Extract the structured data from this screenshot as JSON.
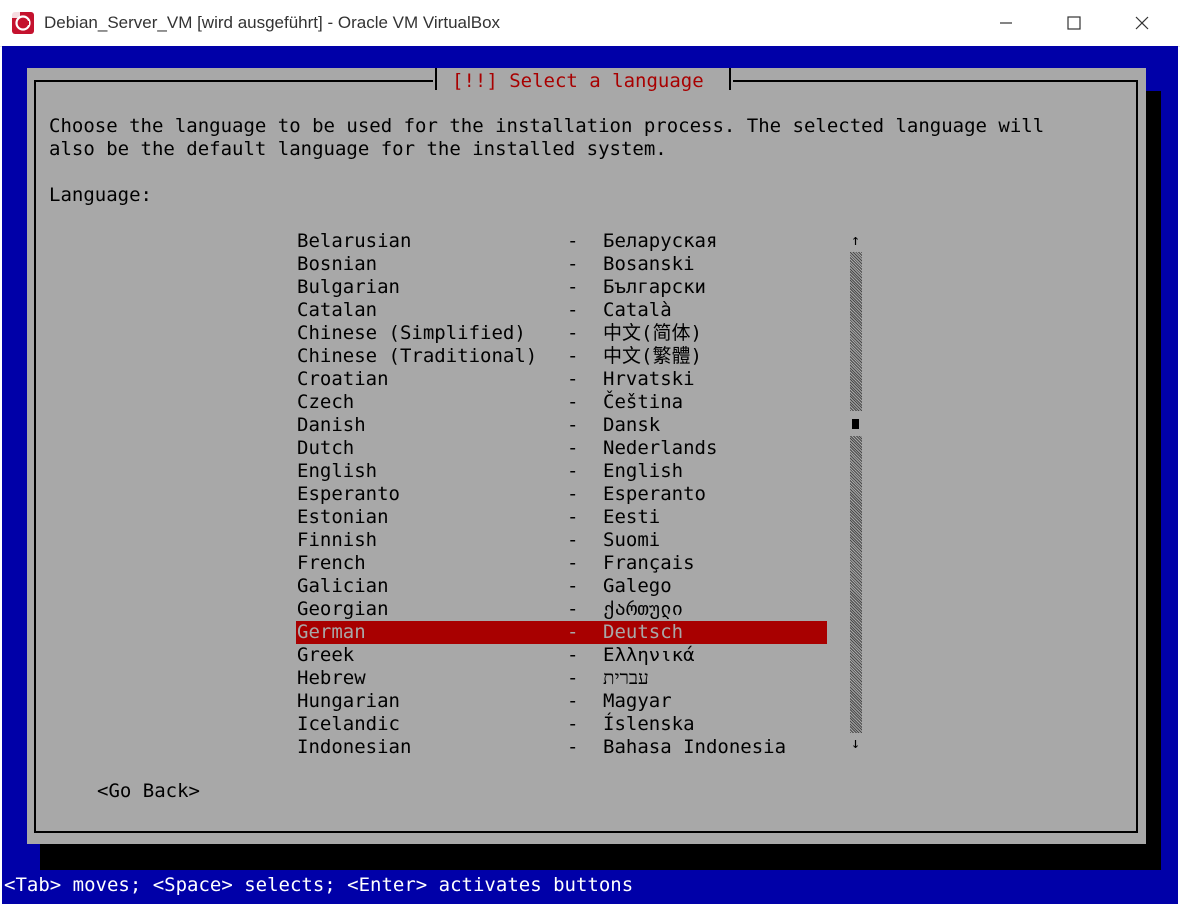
{
  "window": {
    "title": "Debian_Server_VM [wird ausgeführt] - Oracle VM VirtualBox",
    "icon": "virtualbox-debian-icon",
    "controls": {
      "minimize": "minimize-icon",
      "maximize": "maximize-icon",
      "close": "close-icon"
    }
  },
  "colors": {
    "screen_bg": "#0000a8",
    "dialog_bg": "#a8a8a8",
    "title_text": "#a80000",
    "selection_bg": "#a80000",
    "help_text": "#ffffff"
  },
  "dialog": {
    "title": "[!!] Select a language",
    "description_line_1": "Choose the language to be used for the installation process. The selected language will",
    "description_line_2": "also be the default language for the installed system.",
    "list_label": "Language:",
    "go_back": "<Go Back>"
  },
  "languages": [
    {
      "name": "Belarusian",
      "sep": "-",
      "native": "Беларуская"
    },
    {
      "name": "Bosnian",
      "sep": "-",
      "native": "Bosanski"
    },
    {
      "name": "Bulgarian",
      "sep": "-",
      "native": "Български"
    },
    {
      "name": "Catalan",
      "sep": "-",
      "native": "Català"
    },
    {
      "name": "Chinese (Simplified)",
      "sep": "-",
      "native": "中文(简体)"
    },
    {
      "name": "Chinese (Traditional)",
      "sep": "-",
      "native": "中文(繁體)"
    },
    {
      "name": "Croatian",
      "sep": "-",
      "native": "Hrvatski"
    },
    {
      "name": "Czech",
      "sep": "-",
      "native": "Čeština"
    },
    {
      "name": "Danish",
      "sep": "-",
      "native": "Dansk"
    },
    {
      "name": "Dutch",
      "sep": "-",
      "native": "Nederlands"
    },
    {
      "name": "English",
      "sep": "-",
      "native": "English"
    },
    {
      "name": "Esperanto",
      "sep": "-",
      "native": "Esperanto"
    },
    {
      "name": "Estonian",
      "sep": "-",
      "native": "Eesti"
    },
    {
      "name": "Finnish",
      "sep": "-",
      "native": "Suomi"
    },
    {
      "name": "French",
      "sep": "-",
      "native": "Français"
    },
    {
      "name": "Galician",
      "sep": "-",
      "native": "Galego"
    },
    {
      "name": "Georgian",
      "sep": "-",
      "native": "ქართული"
    },
    {
      "name": "German",
      "sep": "-",
      "native": "Deutsch"
    },
    {
      "name": "Greek",
      "sep": "-",
      "native": "Ελληνικά"
    },
    {
      "name": "Hebrew",
      "sep": "-",
      "native": "עברית"
    },
    {
      "name": "Hungarian",
      "sep": "-",
      "native": "Magyar"
    },
    {
      "name": "Icelandic",
      "sep": "-",
      "native": "Íslenska"
    },
    {
      "name": "Indonesian",
      "sep": "-",
      "native": "Bahasa Indonesia"
    }
  ],
  "selected_language": "German",
  "scrollbar": {
    "up_arrow": "↑",
    "down_arrow": "↓"
  },
  "help_bar": "<Tab> moves; <Space> selects; <Enter> activates buttons"
}
